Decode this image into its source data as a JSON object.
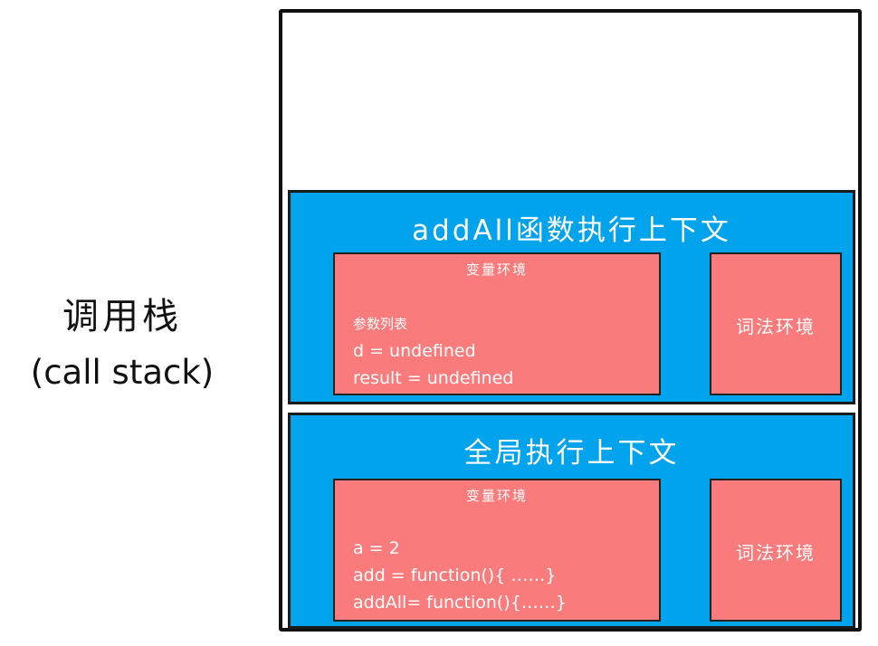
{
  "call_stack": {
    "label_zh": "调用栈",
    "label_en": "(call stack)"
  },
  "contexts": [
    {
      "title": "addAll函数执行上下文",
      "variable_environment": {
        "title": "变量环境",
        "lines": [
          "参数列表",
          "d = undefined",
          "result = undefined"
        ]
      },
      "lexical_environment": {
        "title": "词法环境"
      }
    },
    {
      "title": "全局执行上下文",
      "variable_environment": {
        "title": "变量环境",
        "lines": [
          "a = 2",
          "add = function(){ ……}",
          "addAll= function(){……}"
        ]
      },
      "lexical_environment": {
        "title": "词法环境"
      }
    }
  ],
  "colors": {
    "context_fill": "#00a3ec",
    "environment_fill": "#f97b7b",
    "text_on_fill": "#ffffff",
    "outline": "#111111"
  }
}
